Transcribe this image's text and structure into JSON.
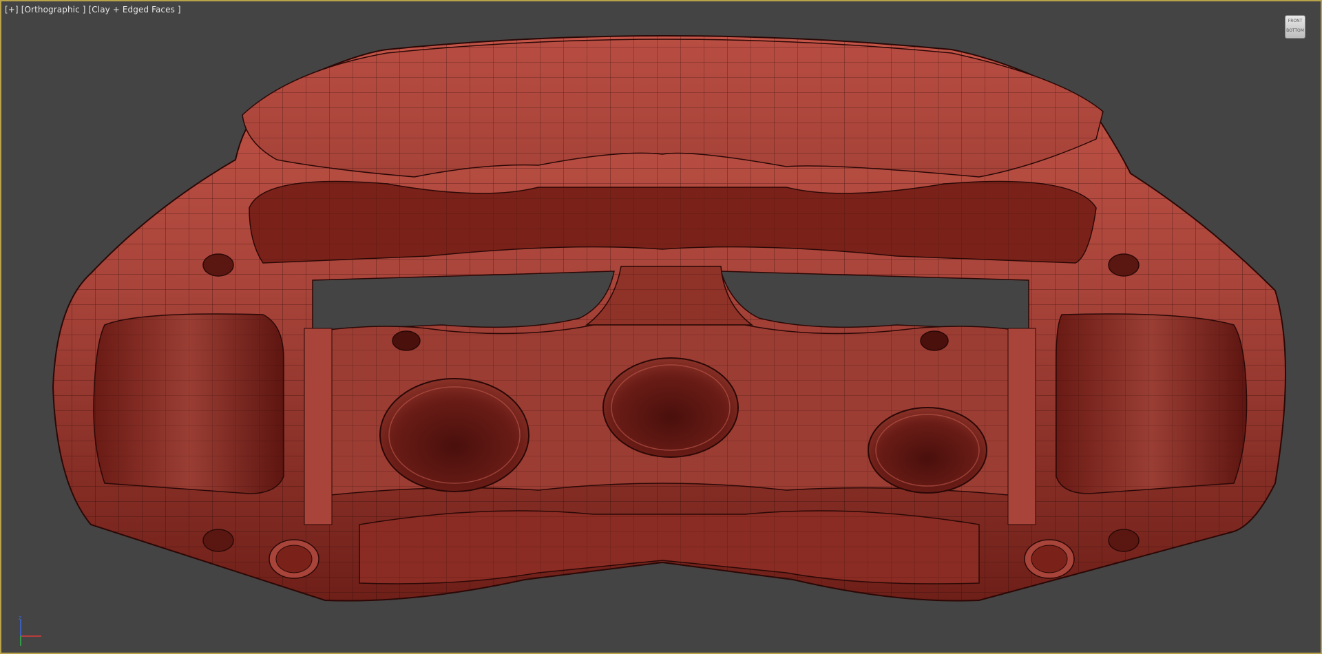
{
  "viewport": {
    "labels": [
      "[+]",
      "[Orthographic ]",
      "[Clay + Edged Faces ]"
    ],
    "border_color": "#b8a24a",
    "background": "#444444"
  },
  "viewcube": {
    "top_label": "FRONT",
    "bottom_label": "BOTTOM"
  },
  "axis_gizmo": {
    "x_color": "#e03a3a",
    "y_color": "#2fb84a",
    "z_color": "#3a6ae0",
    "z_label": "z"
  },
  "model": {
    "name_icon": "brake-caliper-mesh",
    "base_color": "#b0483e",
    "shadow_color": "#5a1712",
    "edge_color": "#2a0806"
  }
}
